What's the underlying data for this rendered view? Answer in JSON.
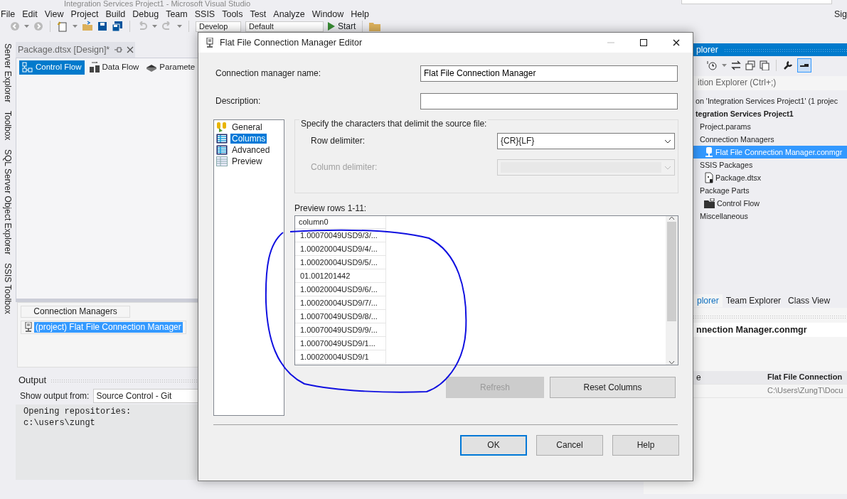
{
  "window": {
    "title": "Integration Services Project1 - Microsoft Visual Studio",
    "account": "Sig"
  },
  "menu": [
    "File",
    "Edit",
    "View",
    "Project",
    "Build",
    "Debug",
    "Team",
    "SSIS",
    "Tools",
    "Test",
    "Analyze",
    "Window",
    "Help"
  ],
  "toolbar": {
    "configuration": "Develop",
    "platform": "Default",
    "start": "Start"
  },
  "side_tabs": [
    "Server Explorer",
    "Toolbox",
    "SQL Server Object Explorer",
    "SSIS Toolbox"
  ],
  "document_tab": {
    "title": "Package.dtsx [Design]*"
  },
  "designer_tabs": [
    {
      "label": "Control Flow",
      "selected": true,
      "kind": "flow"
    },
    {
      "label": "Data Flow",
      "selected": false,
      "kind": "data"
    },
    {
      "label": "Paramete",
      "selected": false,
      "kind": "param"
    }
  ],
  "connection_managers": {
    "tab": "Connection Managers",
    "items": [
      {
        "label": "(project) Flat File Connection Manager",
        "selected": true
      }
    ]
  },
  "output": {
    "title": "Output",
    "show_from_label": "Show output from:",
    "source": "Source Control - Git",
    "lines": [
      "Opening repositories:",
      "c:\\users\\zungt"
    ]
  },
  "solution_explorer": {
    "title": "plorer",
    "search_placeholder": "ition Explorer (Ctrl+;)",
    "tree": [
      {
        "label": "on 'Integration Services Project1' (1 projec",
        "selected": false,
        "children": [
          {
            "label": "tegration Services Project1",
            "kind": "project",
            "selected": false,
            "children": [
              {
                "label": "Project.params",
                "selected": false
              },
              {
                "label": "Connection Managers",
                "selected": false,
                "children": [
                  {
                    "label": "Flat File Connection Manager.conmgr",
                    "kind": "connection",
                    "selected": true
                  }
                ]
              },
              {
                "label": "SSIS Packages",
                "selected": false,
                "children": [
                  {
                    "label": "Package.dtsx",
                    "kind": "package",
                    "selected": false
                  }
                ]
              },
              {
                "label": "Package Parts",
                "selected": false,
                "children": [
                  {
                    "label": "Control Flow",
                    "kind": "folder",
                    "selected": false
                  }
                ]
              },
              {
                "label": "Miscellaneous",
                "selected": false
              }
            ]
          }
        ]
      }
    ]
  },
  "bottom_tabs": [
    {
      "label": "plorer",
      "selected": true
    },
    {
      "label": "Team Explorer",
      "selected": false
    },
    {
      "label": "Class View",
      "selected": false
    }
  ],
  "properties": {
    "object": "nnection Manager.conmgr",
    "header": {
      "column_1": "e",
      "column_2": "Flat File Connection"
    },
    "rows": [
      {
        "value": "C:\\Users\\ZungT\\Docu"
      }
    ]
  },
  "dialog": {
    "title": "Flat File Connection Manager Editor",
    "name_label": "Connection manager name:",
    "name_value": "Flat File Connection Manager",
    "description_label": "Description:",
    "nav": [
      {
        "label": "General",
        "selected": false,
        "kind": "general"
      },
      {
        "label": "Columns",
        "selected": true,
        "kind": "grid"
      },
      {
        "label": "Advanced",
        "selected": false,
        "kind": "grid"
      },
      {
        "label": "Preview",
        "selected": false,
        "kind": "preview"
      }
    ],
    "group_title": "Specify the characters that delimit the source file:",
    "delimiters": [
      {
        "label": "Row delimiter:",
        "value": "{CR}{LF}",
        "disabled": false
      },
      {
        "label": "Column delimiter:",
        "disabled": true
      }
    ],
    "preview_label": "Preview rows 1-11:",
    "grid": {
      "columns": [
        "column0"
      ],
      "rows": [
        "1.00070049USD9/3/...",
        "1.00020004USD9/4/...",
        "1.00020004USD9/5/...",
        "01.001201442",
        "1.00020004USD9/6/...",
        "1.00020004USD9/7/...",
        "1.00070049USD9/8/...",
        "1.00070049USD9/9/...",
        "1.00070049USD9/1...",
        "1.00020004USD9/1"
      ]
    },
    "grid_buttons": [
      {
        "label": "Refresh",
        "disabled": true
      },
      {
        "label": "Reset Columns",
        "disabled": false
      }
    ],
    "buttons": [
      {
        "label": "OK",
        "default": true
      },
      {
        "label": "Cancel",
        "default": false
      },
      {
        "label": "Help",
        "default": false
      }
    ]
  }
}
